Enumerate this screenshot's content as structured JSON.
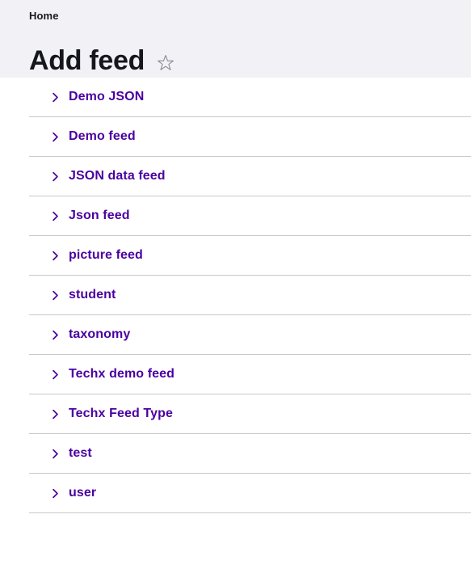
{
  "header": {
    "breadcrumb": {
      "icon": "none",
      "items": [
        {
          "label": "Home"
        }
      ]
    },
    "title": "Add feed",
    "favorite": {
      "icon": "star-outline-icon",
      "state": "off",
      "color": "#8a8a95"
    },
    "background_color": "#f1f1f6"
  },
  "colors": {
    "accent_purple": "#4a00a0",
    "title_text": "#16161d",
    "divider": "#c9c9cd",
    "page_background": "#ffffff"
  },
  "main": {
    "list": {
      "row_icon": "chevron-right-icon",
      "items": [
        {
          "label": "Demo JSON"
        },
        {
          "label": "Demo feed"
        },
        {
          "label": "JSON data feed"
        },
        {
          "label": "Json feed"
        },
        {
          "label": "picture feed"
        },
        {
          "label": "student"
        },
        {
          "label": "taxonomy"
        },
        {
          "label": "Techx demo feed"
        },
        {
          "label": "Techx Feed Type"
        },
        {
          "label": "test"
        },
        {
          "label": "user"
        }
      ]
    }
  }
}
